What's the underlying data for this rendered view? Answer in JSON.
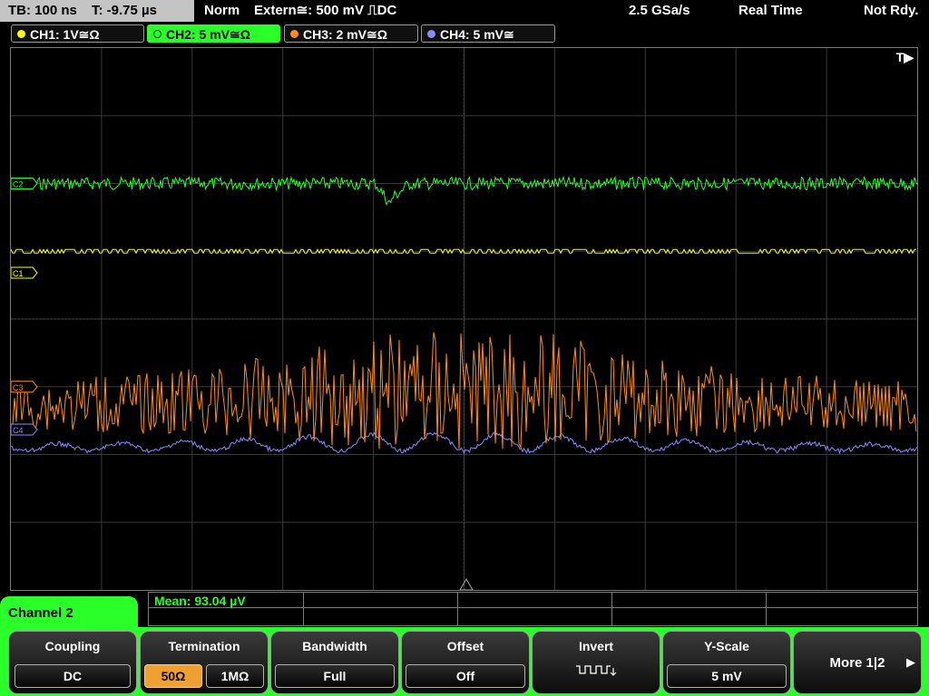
{
  "topbar": {
    "timebase": "TB: 100 ns",
    "trigger_time": "T: -9.75 µs",
    "mode": "Norm",
    "trigger_source": "Extern≅: 500 mV ⎍DC",
    "sample_rate": "2.5 GSa/s",
    "acq_mode": "Real Time",
    "status": "Not Rdy."
  },
  "channels": [
    {
      "label": "CH1: 1V≅Ω",
      "color": "#ffff00",
      "active": false
    },
    {
      "label": "CH2: 5 mV≅Ω",
      "color": "#2aff2a",
      "active": true
    },
    {
      "label": "CH3: 2 mV≅Ω",
      "color": "#ff8c1a",
      "active": false
    },
    {
      "label": "CH4: 5 mV≅",
      "color": "#8a8aff",
      "active": false
    }
  ],
  "markers": {
    "trigger": "T▶",
    "c1": "C1",
    "c2": "C2",
    "c3": "C3",
    "c4": "C4"
  },
  "traces": {
    "ch1": {
      "color": "#ffff00",
      "level_div": -1.0
    },
    "ch2": {
      "color": "#2aff2a",
      "level_div": -2.0
    },
    "ch3": {
      "color": "#ff8c1a",
      "level_div": 1.0
    },
    "ch4": {
      "color": "#8a8aff",
      "level_div": 1.9
    }
  },
  "measurement": {
    "label": "Mean: 93.04 µV"
  },
  "menu": {
    "tab_label": "Channel 2",
    "coupling": {
      "title": "Coupling",
      "value": "DC"
    },
    "termination": {
      "title": "Termination",
      "opt1": "50Ω",
      "opt2": "1MΩ",
      "selected": "50Ω"
    },
    "bandwidth": {
      "title": "Bandwidth",
      "value": "Full"
    },
    "offset": {
      "title": "Offset",
      "value": "Off"
    },
    "invert": {
      "title": "Invert",
      "icon": "invert-waveform-icon"
    },
    "yscale": {
      "title": "Y-Scale",
      "value": "5 mV"
    },
    "more": {
      "label": "More 1|2",
      "icon": "arrow-right-icon"
    }
  }
}
